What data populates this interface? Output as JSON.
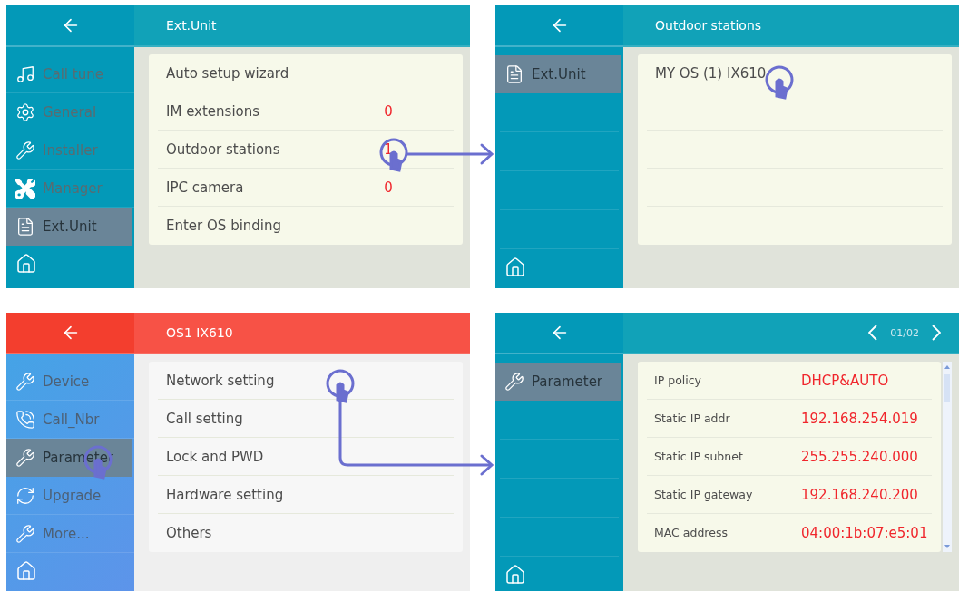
{
  "screens": [
    {
      "color": "#0399b8",
      "kind": "menu",
      "header": {
        "title": "Ext.Unit"
      },
      "sidebar": {
        "items": [
          {
            "kind": "note",
            "label": "Call tune",
            "selected": false
          },
          {
            "kind": "gear",
            "label": "General",
            "selected": false
          },
          {
            "kind": "wrench",
            "label": "Installer",
            "selected": false
          },
          {
            "kind": "tools",
            "label": "Manager",
            "selected": false
          },
          {
            "kind": "list",
            "label": "Ext.Unit",
            "selected": true
          }
        ]
      },
      "rows": [
        {
          "label": "Auto setup wizard"
        },
        {
          "label": "IM extensions",
          "value": "0"
        },
        {
          "label": "Outdoor stations",
          "value": "1"
        },
        {
          "label": "IPC camera",
          "value": "0"
        },
        {
          "label": "Enter OS binding"
        }
      ]
    },
    {
      "color": "#0399b8",
      "kind": "menu",
      "header": {
        "title": "Outdoor stations"
      },
      "sidebar": {
        "items": [
          {
            "kind": "list",
            "label": "Ext.Unit",
            "selected": true
          }
        ]
      },
      "rows": [
        {
          "label": "MY OS (1) IX610"
        }
      ]
    },
    {
      "color": "#f33e2e",
      "kind": "menu",
      "header": {
        "title": "OS1 IX610"
      },
      "sidebar": {
        "items": [
          {
            "kind": "wrench",
            "label": "Device",
            "selected": false
          },
          {
            "kind": "phone",
            "label": "Call_Nbr",
            "selected": false
          },
          {
            "kind": "wrench",
            "label": "Parameter",
            "selected": true
          },
          {
            "kind": "refresh",
            "label": "Upgrade",
            "selected": false
          },
          {
            "kind": "wrench",
            "label": "More...",
            "selected": false
          }
        ]
      },
      "rows": [
        {
          "label": "Network setting"
        },
        {
          "label": "Call setting"
        },
        {
          "label": "Lock and PWD"
        },
        {
          "label": "Hardware setting"
        },
        {
          "label": "Others"
        }
      ]
    },
    {
      "color": "#0399b8",
      "kind": "parameters",
      "header": {
        "page": "01/02"
      },
      "sidebar": {
        "items": [
          {
            "kind": "wrench",
            "label": "Parameter",
            "selected": true
          }
        ]
      },
      "rows": [
        {
          "label": "IP policy",
          "value": "DHCP&AUTO"
        },
        {
          "label": "Static IP addr",
          "value": "192.168.254.019"
        },
        {
          "label": "Static IP subnet",
          "value": "255.255.240.000"
        },
        {
          "label": "Static IP gateway",
          "value": "192.168.240.200"
        },
        {
          "label": "MAC address",
          "value": "04:00:1b:07:e5:01"
        }
      ]
    }
  ]
}
